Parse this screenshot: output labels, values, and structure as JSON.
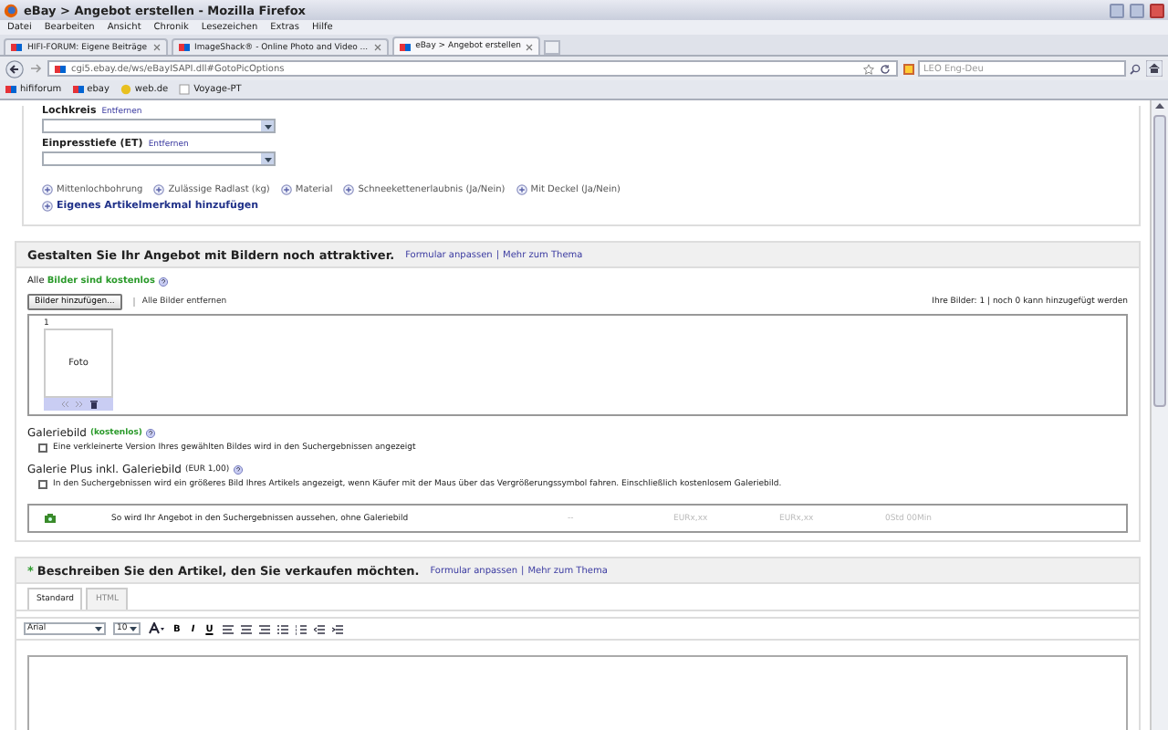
{
  "window": {
    "title": "eBay > Angebot erstellen - Mozilla Firefox"
  },
  "menu": [
    "Datei",
    "Bearbeiten",
    "Ansicht",
    "Chronik",
    "Lesezeichen",
    "Extras",
    "Hilfe"
  ],
  "tabs": [
    {
      "label": "HIFI-FORUM: Eigene Beiträge",
      "selected": false
    },
    {
      "label": "ImageShack® - Online Photo and Video ...",
      "selected": false
    },
    {
      "label": "eBay > Angebot erstellen",
      "selected": true
    }
  ],
  "address": {
    "url": "cgi5.ebay.de/ws/eBayISAPI.dll#GotoPicOptions"
  },
  "search": {
    "placeholder": "LEO Eng-Deu"
  },
  "bookmarks": [
    "hififorum",
    "ebay",
    "web.de",
    "Voyage-PT"
  ],
  "specifics": {
    "fields": [
      {
        "label": "Lochkreis",
        "remove": "Entfernen"
      },
      {
        "label": "Einpresstiefe (ET)",
        "remove": "Entfernen"
      }
    ],
    "suggestions": [
      "Mittenlochbohrung",
      "Zulässige Radlast (kg)",
      "Material",
      "Schneekettenerlaubnis (Ja/Nein)",
      "Mit Deckel (Ja/Nein)"
    ],
    "add_own": "Eigenes Artikelmerkmal hinzufügen"
  },
  "pictures": {
    "title": "Gestalten Sie Ihr Angebot mit Bildern noch attraktiver.",
    "links": [
      "Formular anpassen",
      "Mehr zum Thema"
    ],
    "separator": "|",
    "free_note": "Alle **Bilder sind kostenlos**",
    "add_button": "Bilder hinzufügen...",
    "remove_all": "Alle Bilder entfernen",
    "count": "Ihre Bilder: 1 | noch 0 kann hinzugefügt werden",
    "slots": [
      {
        "number": "1",
        "label": "Foto"
      }
    ],
    "options": [
      {
        "title": "Galeriebild",
        "price": "(kostenlos)",
        "kind": "free",
        "text": "Eine verkleinerte Version Ihres gewählten Bildes wird in den Suchergebnissen angezeigt",
        "checked": false
      },
      {
        "title": "Galerie Plus inkl. Galeriebild",
        "price": "(EUR 1,00)",
        "kind": "paid",
        "text": "In den Suchergebnissen wird ein größeres Bild Ihres Artikels angezeigt, wenn Käufer mit der Maus über das Vergrößerungssymbol fahren. Einschließlich kostenlosem Galeriebild.",
        "checked": false
      }
    ],
    "preview": {
      "text": "So wird Ihr Angebot in den Suchergebnissen aussehen, ohne Galeriebild",
      "columns": [
        "--",
        "EURx,xx",
        "EURx,xx",
        "0Std 00Min"
      ]
    }
  },
  "description": {
    "required_mark": "*",
    "title": "Beschreiben Sie den Artikel, den Sie verkaufen möchten.",
    "links": [
      "Formular anpassen",
      "Mehr zum Thema"
    ],
    "separator": "|",
    "tabs": [
      {
        "label": "Standard",
        "selected": true
      },
      {
        "label": "HTML",
        "selected": false
      }
    ],
    "font": "Arial",
    "size": "10",
    "format_buttons": [
      "B",
      "I",
      "U"
    ]
  }
}
